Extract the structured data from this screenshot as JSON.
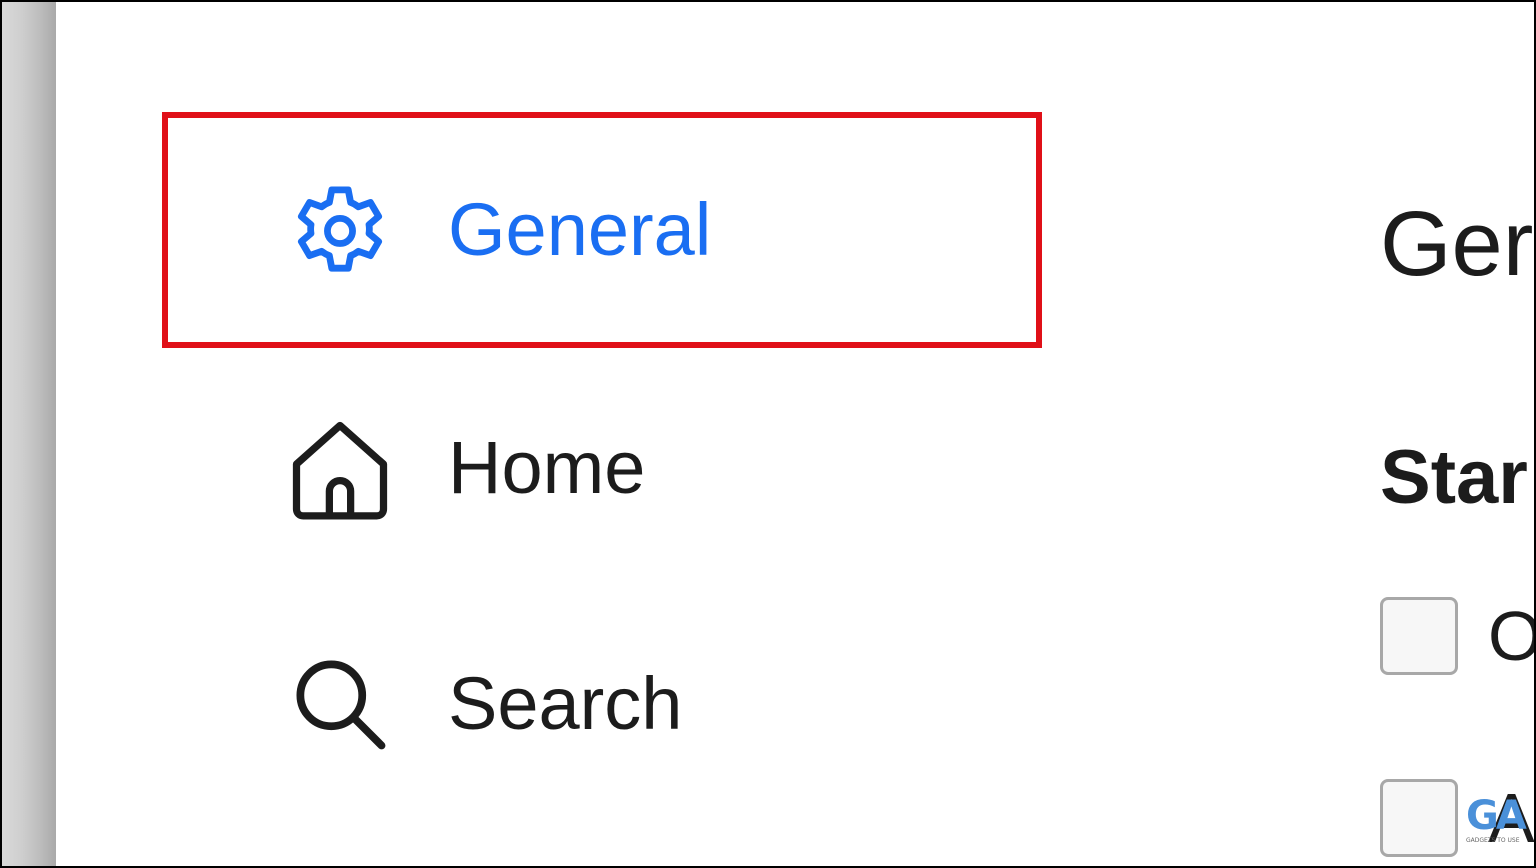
{
  "sidebar": {
    "items": [
      {
        "label": "General",
        "icon": "gear-icon",
        "selected": true
      },
      {
        "label": "Home",
        "icon": "home-icon",
        "selected": false
      },
      {
        "label": "Search",
        "icon": "search-icon",
        "selected": false
      }
    ]
  },
  "main": {
    "title": "Ger",
    "section_heading": "Star",
    "checkboxes": [
      {
        "label": "O",
        "checked": false
      },
      {
        "label": "A",
        "checked": false
      }
    ]
  },
  "watermark": {
    "logo": "GA",
    "tagline": "GADGETS TO USE"
  },
  "colors": {
    "selected": "#1a6ef2",
    "highlight_border": "#e01018",
    "text": "#1c1c1c"
  }
}
